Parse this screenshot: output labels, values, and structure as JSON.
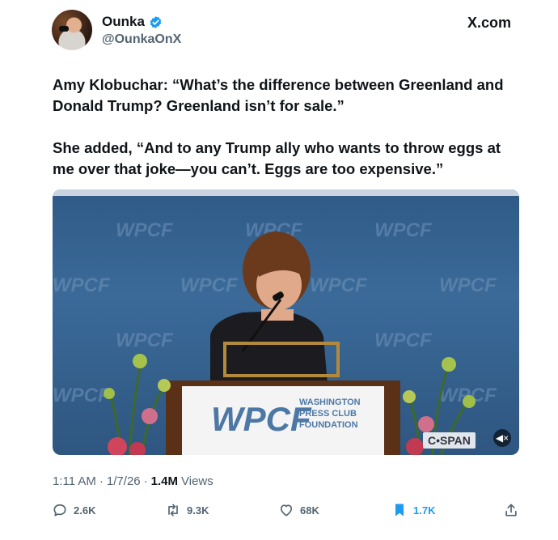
{
  "header": {
    "display_name": "Ounka",
    "handle": "@OunkaOnX",
    "brand": "X.com"
  },
  "tweet": {
    "paragraph1": "Amy Klobuchar: “What’s the difference between Greenland and Donald Trump? Greenland isn’t for sale.”",
    "paragraph2": "She added, “And to any Trump ally who wants to throw eggs at me over that joke—you can’t. Eggs are too expensive.”"
  },
  "media": {
    "backdrop_logo": "WPCF",
    "podium_logo": "WPCF",
    "podium_org_line1": "WASHINGTON",
    "podium_org_line2": "PRESS CLUB",
    "podium_org_line3": "FOUNDATION",
    "watermark": "C•SPAN"
  },
  "meta": {
    "time": "1:11 AM",
    "date": "1/7/26",
    "views_count": "1.4M",
    "views_label": "Views",
    "separator": "·"
  },
  "actions": {
    "replies": "2.6K",
    "reposts": "9.3K",
    "likes": "68K",
    "bookmarks": "1.7K"
  },
  "colors": {
    "accent": "#1d9bf0",
    "secondary_text": "#536471",
    "primary_text": "#0f1419"
  }
}
